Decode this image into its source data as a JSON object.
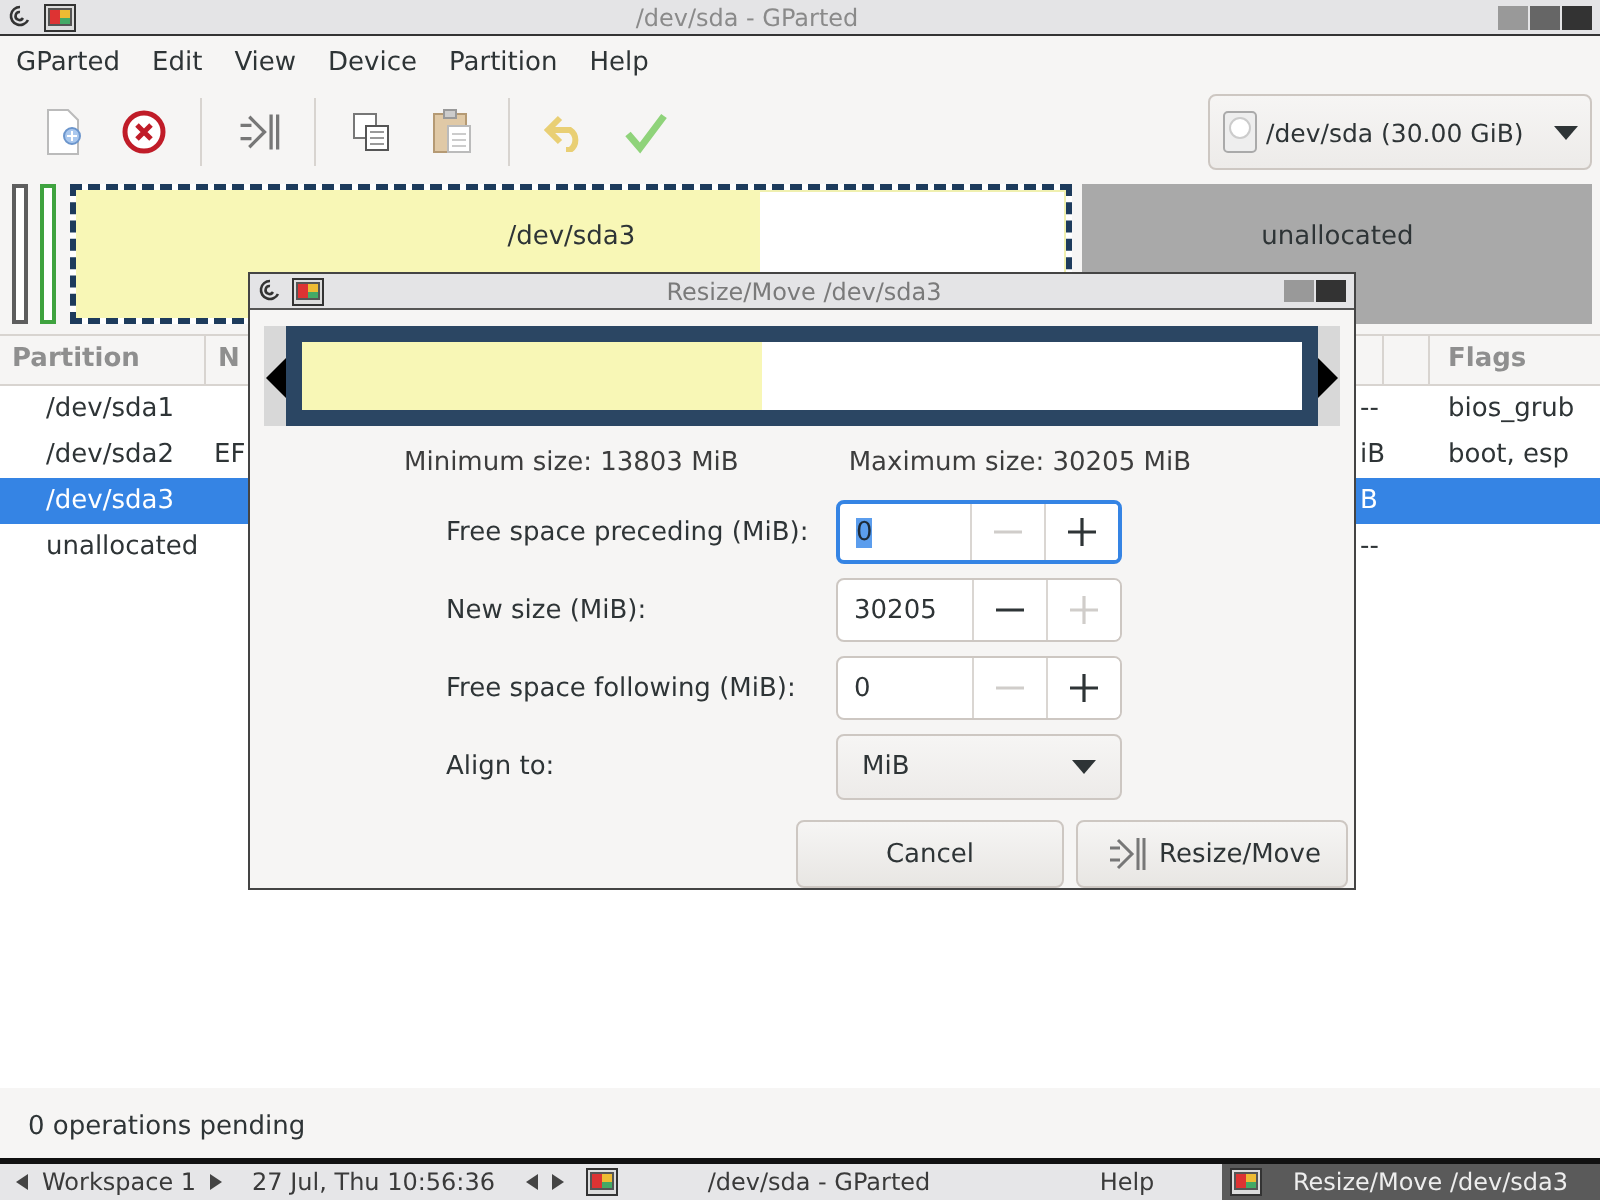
{
  "window": {
    "title": "/dev/sda - GParted"
  },
  "menu": [
    "GParted",
    "Edit",
    "View",
    "Device",
    "Partition",
    "Help"
  ],
  "device_selector": {
    "label": "/dev/sda (30.00 GiB)"
  },
  "disk_map": [
    {
      "kind": "sliver",
      "color": "#5e5e5e"
    },
    {
      "kind": "sliver",
      "color": "#3fa33f"
    },
    {
      "kind": "partition",
      "name": "/dev/sda3",
      "level": 0.69,
      "selected": true
    },
    {
      "kind": "unallocated",
      "name": "unallocated"
    }
  ],
  "table": {
    "columns": [
      "Partition",
      "N",
      "Flags"
    ],
    "rows": [
      {
        "partition": "/dev/sda1",
        "column_3": "--",
        "flags": "bios_grub",
        "selected": false
      },
      {
        "partition": "/dev/sda2",
        "name": "EF",
        "column_3": "iB",
        "flags": "boot, esp",
        "selected": false
      },
      {
        "partition": "/dev/sda3",
        "column_3": "B",
        "selected": true
      },
      {
        "partition": "unallocated",
        "column_3": "--",
        "selected": false
      }
    ]
  },
  "status_bar": "0 operations pending",
  "dialog": {
    "title": "Resize/Move /dev/sda3",
    "level": 0.46,
    "minimum": "Minimum size: 13803 MiB",
    "maximum": "Maximum size: 30205 MiB",
    "fields": [
      {
        "label": "Free space preceding (MiB):",
        "value": "0",
        "focused": true,
        "minus_enabled": false,
        "plus_enabled": true
      },
      {
        "label": "New size (MiB):",
        "value": "30205",
        "focused": false,
        "minus_enabled": true,
        "plus_enabled": false
      },
      {
        "label": "Free space following (MiB):",
        "value": "0",
        "focused": false,
        "minus_enabled": false,
        "plus_enabled": true
      }
    ],
    "align": {
      "label": "Align to:",
      "value": "MiB"
    },
    "buttons": [
      {
        "label": "Cancel",
        "kind": "plain"
      },
      {
        "label": "Resize/Move",
        "kind": "resize"
      }
    ]
  },
  "taskbar": {
    "workspace": "Workspace 1",
    "clock": "27 Jul, Thu 10:56:36",
    "tasks": [
      {
        "label": "/dev/sda - GParted",
        "selected": false
      },
      {
        "label": "Help",
        "selected": false
      },
      {
        "label": "Resize/Move /dev/sda3",
        "selected": true
      }
    ]
  }
}
